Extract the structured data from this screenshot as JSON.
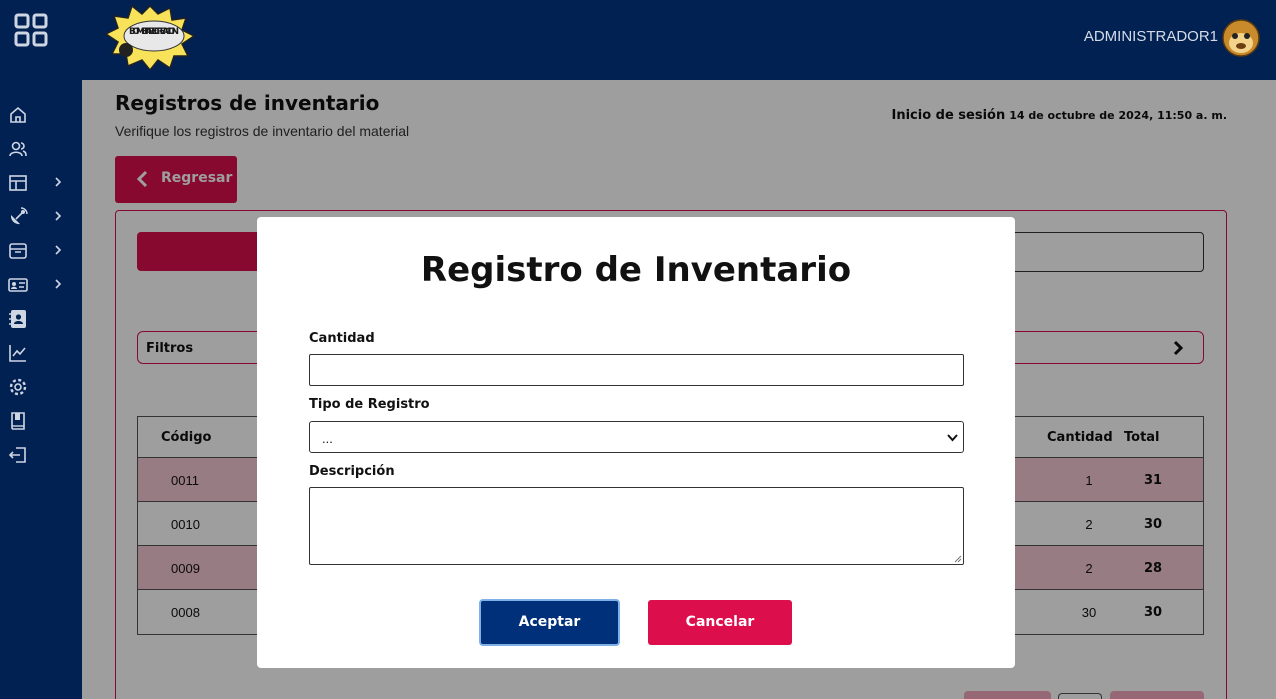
{
  "header": {
    "admin_name": "ADMINISTRADOR1",
    "logo_text": "BOMBITA RECREACION"
  },
  "sidebar": {
    "items": [
      {
        "icon": "home-icon",
        "has_submenu": false
      },
      {
        "icon": "users-icon",
        "has_submenu": false
      },
      {
        "icon": "layout-icon",
        "has_submenu": true
      },
      {
        "icon": "satellite-dish-icon",
        "has_submenu": true
      },
      {
        "icon": "archive-icon",
        "has_submenu": true
      },
      {
        "icon": "id-card-icon",
        "has_submenu": true
      },
      {
        "icon": "contacts-book-icon",
        "has_submenu": false
      },
      {
        "icon": "chart-line-icon",
        "has_submenu": false
      },
      {
        "icon": "gear-icon",
        "has_submenu": false
      },
      {
        "icon": "book-icon",
        "has_submenu": false
      },
      {
        "icon": "logout-icon",
        "has_submenu": false
      }
    ]
  },
  "page": {
    "title": "Registros de inventario",
    "subtitle": "Verifique los registros de inventario del material",
    "session_label": "Inicio de sesión",
    "session_date": "14 de octubre de 2024, 11:50 a. m.",
    "back_label": "Regresar",
    "filters_label": "Filtros"
  },
  "table": {
    "headers": [
      "Código",
      "Cantidad",
      "Total"
    ],
    "rows": [
      {
        "code": "0011",
        "qty": "1",
        "total": "31"
      },
      {
        "code": "0010",
        "qty": "2",
        "total": "30"
      },
      {
        "code": "0009",
        "qty": "2",
        "total": "28"
      },
      {
        "code": "0008",
        "qty": "30",
        "total": "30"
      }
    ]
  },
  "modal": {
    "title": "Registro de Inventario",
    "quantity_label": "Cantidad",
    "quantity_value": "",
    "type_label": "Tipo de Registro",
    "type_value": "...",
    "description_label": "Descripción",
    "description_value": "",
    "accept_label": "Aceptar",
    "cancel_label": "Cancelar"
  },
  "colors": {
    "navy": "#002152",
    "accent_red": "#dc0f4c",
    "accept_blue": "#00307a",
    "row_pink": "#f6c8d5"
  }
}
